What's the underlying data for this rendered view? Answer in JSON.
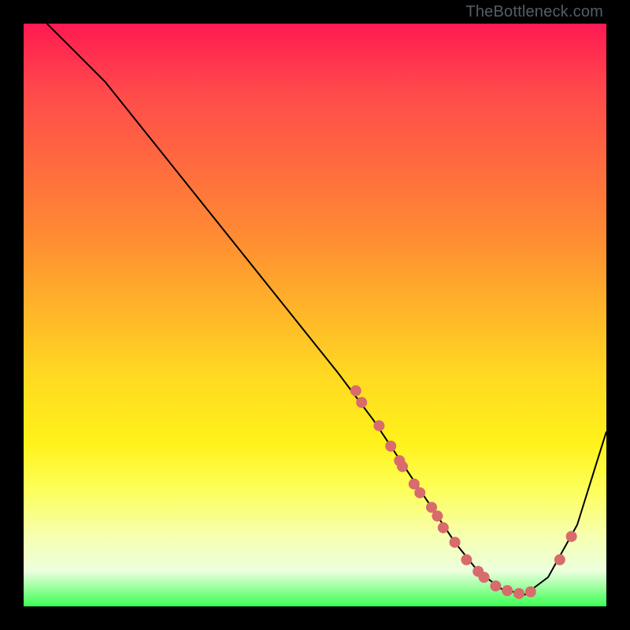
{
  "watermark": "TheBottleneck.com",
  "chart_data": {
    "type": "line",
    "title": "",
    "xlabel": "",
    "ylabel": "",
    "xlim": [
      0,
      100
    ],
    "ylim": [
      0,
      100
    ],
    "grid": false,
    "legend": false,
    "series": [
      {
        "name": "curve",
        "x": [
          4,
          8,
          14,
          22,
          30,
          38,
          46,
          54,
          60,
          66,
          70,
          74,
          78,
          82,
          86,
          90,
          95,
          100
        ],
        "y": [
          100,
          96,
          90,
          80,
          70,
          60,
          50,
          40,
          32,
          23,
          17,
          11,
          6,
          3,
          2,
          5,
          14,
          30
        ],
        "color": "#000000",
        "line_width": 2
      }
    ],
    "scatter_points": {
      "color": "#d86b6b",
      "radius": 7,
      "points": [
        {
          "x": 57,
          "y": 37
        },
        {
          "x": 58,
          "y": 35
        },
        {
          "x": 61,
          "y": 31
        },
        {
          "x": 63,
          "y": 27.5
        },
        {
          "x": 64.5,
          "y": 25
        },
        {
          "x": 65,
          "y": 24
        },
        {
          "x": 67,
          "y": 21
        },
        {
          "x": 68,
          "y": 19.5
        },
        {
          "x": 70,
          "y": 17
        },
        {
          "x": 71,
          "y": 15.5
        },
        {
          "x": 72,
          "y": 13.5
        },
        {
          "x": 74,
          "y": 11
        },
        {
          "x": 76,
          "y": 8
        },
        {
          "x": 78,
          "y": 6
        },
        {
          "x": 79,
          "y": 5
        },
        {
          "x": 81,
          "y": 3.5
        },
        {
          "x": 83,
          "y": 2.7
        },
        {
          "x": 85,
          "y": 2.2
        },
        {
          "x": 87,
          "y": 2.5
        },
        {
          "x": 92,
          "y": 8
        },
        {
          "x": 94,
          "y": 12
        }
      ]
    }
  }
}
